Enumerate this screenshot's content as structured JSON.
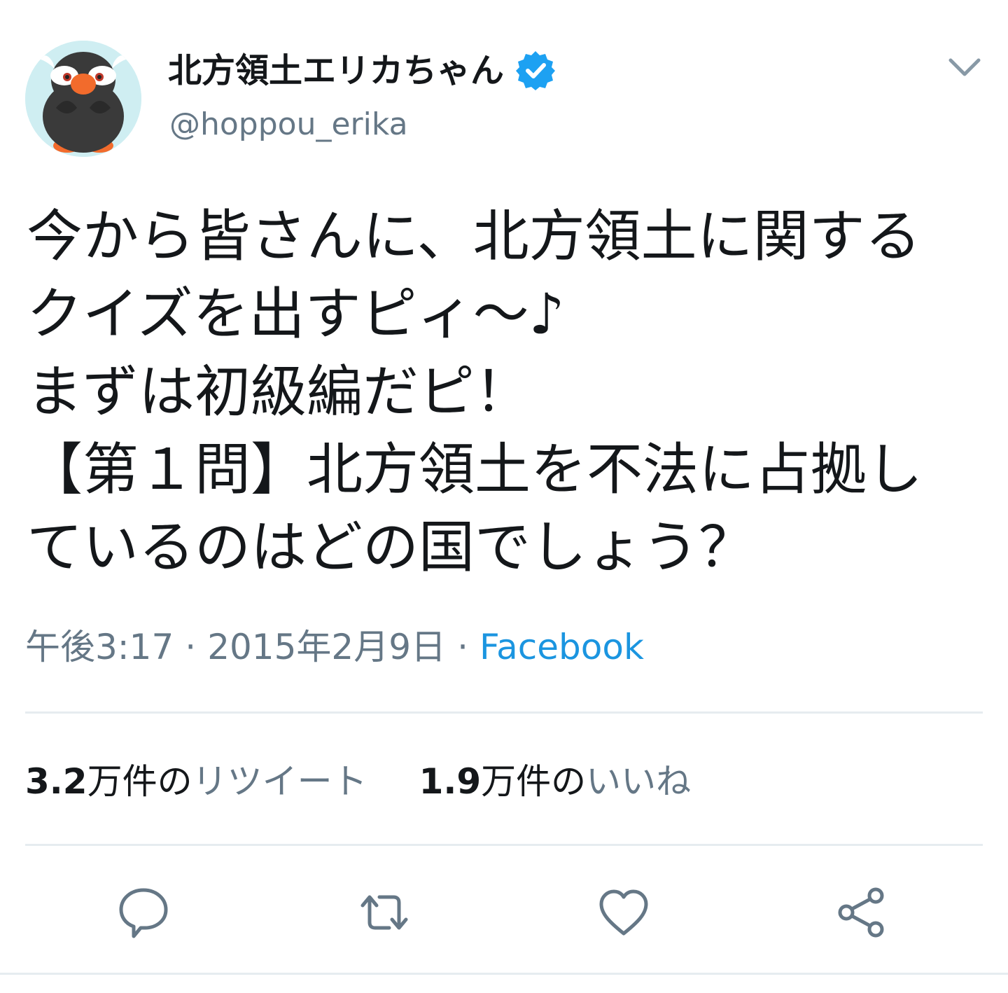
{
  "tweet": {
    "author": {
      "display_name": "北方領土エリカちゃん",
      "handle": "@hoppou_erika",
      "verified": true,
      "avatar_icon": "penguin-mascot-avatar"
    },
    "text_lines": [
      "今から皆さんに、北方領土に関する",
      "クイズを出すピィ～♪",
      "まずは初級編だピ！",
      "【第１問】北方領土を不法に占拠し",
      "ているのはどの国でしょう？"
    ],
    "meta": {
      "time": "午後3:17",
      "separator": "·",
      "date": "2015年2月9日",
      "source": "Facebook"
    },
    "stats": {
      "retweets": {
        "count": "3.2",
        "unit": "万件の",
        "label": "リツイート"
      },
      "likes": {
        "count": "1.9",
        "unit": "万件の",
        "label": "いいね"
      }
    },
    "actions": {
      "reply": "reply-icon",
      "retweet": "retweet-icon",
      "like": "heart-icon",
      "share": "share-icon"
    }
  },
  "colors": {
    "text_primary": "#14171a",
    "text_secondary": "#657786",
    "link": "#1b95e0",
    "verified_badge": "#1da1f2",
    "divider": "#e6ecf0",
    "icon": "#657786"
  }
}
